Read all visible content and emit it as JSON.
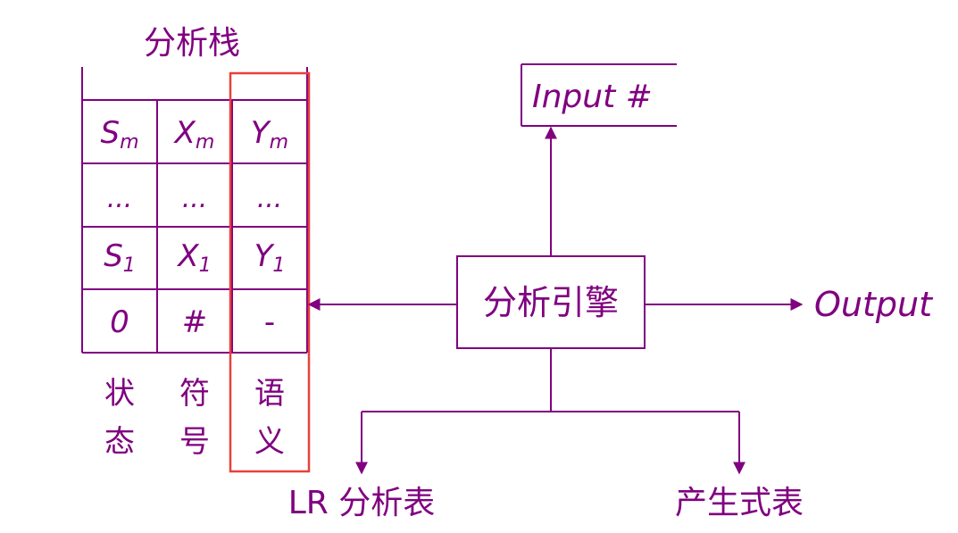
{
  "colors": {
    "line": "#800080",
    "text": "#800080",
    "highlight": "#e8403c",
    "background": "#ffffff"
  },
  "stack": {
    "title": "分析栈",
    "rows": [
      {
        "state": "S",
        "state_sub": "m",
        "symbol": "X",
        "symbol_sub": "m",
        "semantic": "Y",
        "semantic_sub": "m"
      },
      {
        "state": "...",
        "state_sub": "",
        "symbol": "...",
        "symbol_sub": "",
        "semantic": "...",
        "semantic_sub": ""
      },
      {
        "state": "S",
        "state_sub": "1",
        "symbol": "X",
        "symbol_sub": "1",
        "semantic": "Y",
        "semantic_sub": "1"
      },
      {
        "state": "0",
        "state_sub": "",
        "symbol": "#",
        "symbol_sub": "",
        "semantic": "-",
        "semantic_sub": ""
      }
    ],
    "columns": [
      {
        "line1": "状",
        "line2": "态"
      },
      {
        "line1": "符",
        "line2": "号"
      },
      {
        "line1": "语",
        "line2": "义"
      }
    ]
  },
  "input": {
    "label": "Input #"
  },
  "engine": {
    "label": "分析引擎"
  },
  "output": {
    "label": "Output"
  },
  "lr_table": {
    "label": "LR 分析表"
  },
  "production_table": {
    "label": "产生式表"
  }
}
